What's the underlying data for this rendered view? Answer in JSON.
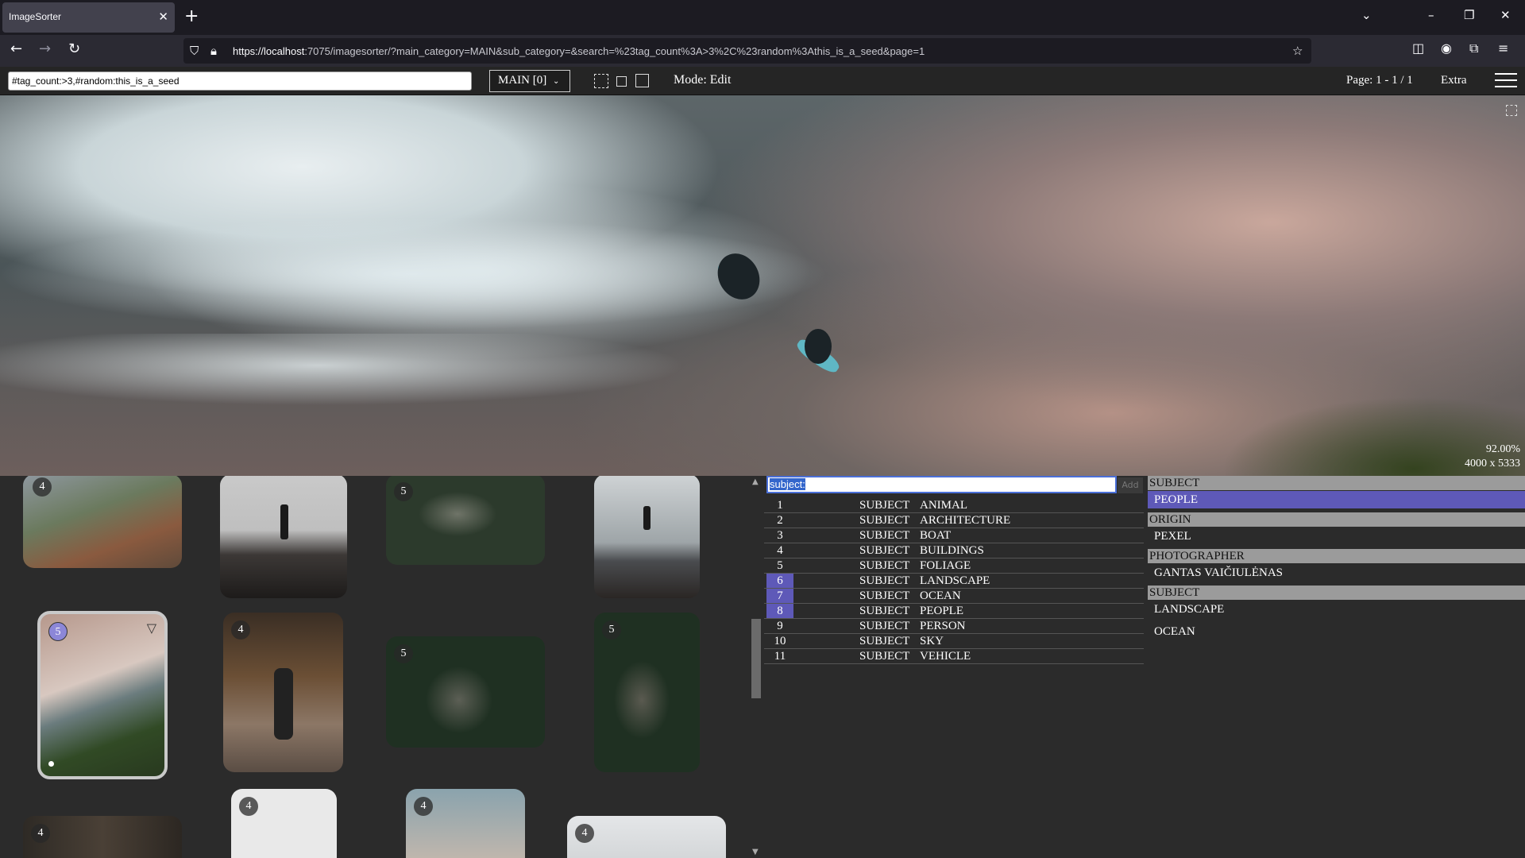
{
  "browser": {
    "tab_title": "ImageSorter",
    "url_host": "https://localhost",
    "url_rest": ":7075/imagesorter/?main_category=MAIN&sub_category=&search=%23tag_count%3A>3%2C%23random%3Athis_is_a_seed&page=1"
  },
  "toolbar": {
    "search_value": "#tag_count:>3,#random:this_is_a_seed",
    "category": "MAIN [0]",
    "mode": "Mode: Edit",
    "page_info": "Page: 1 - 1 / 1",
    "extra": "Extra"
  },
  "preview": {
    "zoom": "92.00%",
    "dimensions": "4000 x 5333"
  },
  "thumbnails": [
    {
      "badge": "4",
      "selected": false
    },
    {
      "badge": "",
      "selected": false
    },
    {
      "badge": "5",
      "selected": false
    },
    {
      "badge": "",
      "selected": false
    },
    {
      "badge": "5",
      "selected": true
    },
    {
      "badge": "4",
      "selected": false
    },
    {
      "badge": "5",
      "selected": false
    },
    {
      "badge": "5",
      "selected": false
    },
    {
      "badge": "4",
      "selected": false
    },
    {
      "badge": "4",
      "selected": false
    },
    {
      "badge": "4",
      "selected": false
    },
    {
      "badge": "4",
      "selected": false
    }
  ],
  "tag_input": {
    "value": "subject:",
    "add_label": "Add"
  },
  "tag_list": [
    {
      "num": "1",
      "category": "SUBJECT",
      "name": "ANIMAL",
      "active": false
    },
    {
      "num": "2",
      "category": "SUBJECT",
      "name": "ARCHITECTURE",
      "active": false
    },
    {
      "num": "3",
      "category": "SUBJECT",
      "name": "BOAT",
      "active": false
    },
    {
      "num": "4",
      "category": "SUBJECT",
      "name": "BUILDINGS",
      "active": false
    },
    {
      "num": "5",
      "category": "SUBJECT",
      "name": "FOLIAGE",
      "active": false
    },
    {
      "num": "6",
      "category": "SUBJECT",
      "name": "LANDSCAPE",
      "active": true
    },
    {
      "num": "7",
      "category": "SUBJECT",
      "name": "OCEAN",
      "active": true
    },
    {
      "num": "8",
      "category": "SUBJECT",
      "name": "PEOPLE",
      "active": true
    },
    {
      "num": "9",
      "category": "SUBJECT",
      "name": "PERSON",
      "active": false
    },
    {
      "num": "10",
      "category": "SUBJECT",
      "name": "SKY",
      "active": false
    },
    {
      "num": "11",
      "category": "SUBJECT",
      "name": "VEHICLE",
      "active": false
    }
  ],
  "assigned": {
    "groups": [
      {
        "header": "SUBJECT",
        "items": [
          "PEOPLE"
        ]
      },
      {
        "header": "ORIGIN",
        "items": [
          "PEXEL"
        ]
      },
      {
        "header": "PHOTOGRAPHER",
        "items": [
          "GANTAS VAIČIULĖNAS"
        ]
      },
      {
        "header": "SUBJECT",
        "items": [
          "LANDSCAPE",
          "OCEAN"
        ]
      }
    ]
  },
  "colors": {
    "accent": "#5e59b8",
    "selected_badge": "#8c87d8",
    "header_bg": "#9b9b9b"
  }
}
